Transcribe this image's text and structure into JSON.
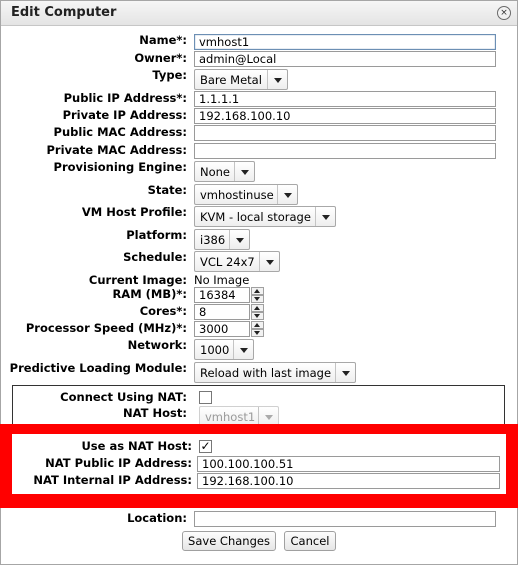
{
  "dialog": {
    "title": "Edit Computer"
  },
  "form": {
    "name": {
      "label": "Name*:",
      "value": "vmhost1"
    },
    "owner": {
      "label": "Owner*:",
      "value": "admin@Local"
    },
    "type": {
      "label": "Type:",
      "value": "Bare Metal"
    },
    "public_ip": {
      "label": "Public IP Address*:",
      "value": "1.1.1.1"
    },
    "private_ip": {
      "label": "Private IP Address:",
      "value": "192.168.100.10"
    },
    "public_mac": {
      "label": "Public MAC Address:",
      "value": ""
    },
    "private_mac": {
      "label": "Private MAC Address:",
      "value": ""
    },
    "prov_engine": {
      "label": "Provisioning Engine:",
      "value": "None"
    },
    "state": {
      "label": "State:",
      "value": "vmhostinuse"
    },
    "vm_host_profile": {
      "label": "VM Host Profile:",
      "value": "KVM - local storage"
    },
    "platform": {
      "label": "Platform:",
      "value": "i386"
    },
    "schedule": {
      "label": "Schedule:",
      "value": "VCL 24x7"
    },
    "current_image": {
      "label": "Current Image:",
      "value": "No Image"
    },
    "ram": {
      "label": "RAM (MB)*:",
      "value": "16384"
    },
    "cores": {
      "label": "Cores*:",
      "value": "8"
    },
    "proc_speed": {
      "label": "Processor Speed (MHz)*:",
      "value": "3000"
    },
    "network": {
      "label": "Network:",
      "value": "1000"
    },
    "predictive": {
      "label": "Predictive Loading Module:",
      "value": "Reload with last image"
    },
    "connect_nat": {
      "label": "Connect Using NAT:",
      "checked": false
    },
    "nat_host": {
      "label": "NAT Host:",
      "value": "vmhost1"
    },
    "use_as_nat_host": {
      "label": "Use as NAT Host:",
      "checked": true,
      "mark": "✓"
    },
    "nat_public_ip": {
      "label": "NAT Public IP Address:",
      "value": "100.100.100.51"
    },
    "nat_internal_ip": {
      "label": "NAT Internal IP Address:",
      "value": "192.168.100.10"
    },
    "location": {
      "label": "Location:",
      "value": ""
    }
  },
  "buttons": {
    "save": "Save Changes",
    "cancel": "Cancel"
  },
  "icons": {
    "close": "×"
  },
  "colors": {
    "highlight": "#ff0000"
  }
}
